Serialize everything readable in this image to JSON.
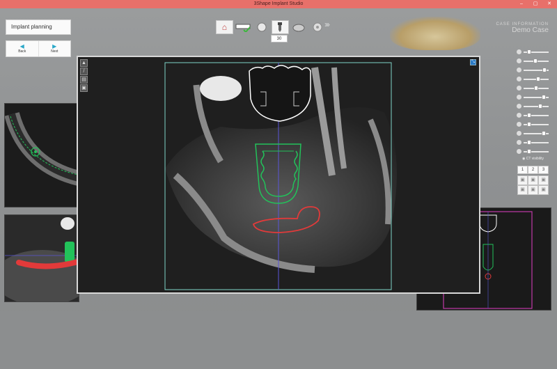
{
  "window": {
    "title": "3Shape Implant Studio",
    "controls": [
      "–",
      "▢",
      "✕"
    ]
  },
  "planning_panel": {
    "label": "Implant planning"
  },
  "navigation": {
    "back_label": "Back",
    "next_label": "Next"
  },
  "toolbar": {
    "tools": [
      "home-icon",
      "panoramic-icon",
      "crown-icon",
      "implant-icon",
      "guide-icon",
      "export-icon"
    ],
    "zoom_value": "30"
  },
  "case": {
    "line1": "CASE INFORMATION",
    "line2": "Demo Case"
  },
  "right_panel": {
    "sliders": [
      {
        "icon": "implant-visibility-icon",
        "value": 0.15
      },
      {
        "icon": "crown-visibility-icon",
        "value": 0.45
      },
      {
        "icon": "guide-visibility-icon",
        "value": 0.9
      },
      {
        "icon": "abutment-visibility-icon",
        "value": 0.6
      },
      {
        "icon": "sleeve-visibility-icon",
        "value": 0.5
      },
      {
        "icon": "ct-visibility-icon",
        "value": 0.85
      },
      {
        "icon": "tooth-visibility-icon",
        "value": 0.7
      },
      {
        "icon": "scan-visibility-icon",
        "value": 0.15
      },
      {
        "icon": "nerve-visibility-icon",
        "value": 0.15
      },
      {
        "icon": "model-visibility-icon",
        "value": 0.85
      },
      {
        "icon": "settings-visibility-icon",
        "value": 0.15
      },
      {
        "icon": "contrast-icon",
        "value": 0.15
      }
    ],
    "ct_visibility_label": "CT visibility",
    "layout_tabs": [
      "1",
      "2",
      "3"
    ],
    "view_buttons": [
      "view-front-icon",
      "view-side-icon",
      "view-top-icon",
      "view-back-icon",
      "view-left-icon",
      "view-right-icon"
    ]
  },
  "colors": {
    "implant_outline": "#22c25a",
    "nerve_canal": "#e23a3a",
    "crown_outline": "#ffffff",
    "crosshair_vertical": "#5a56d8",
    "frame_cyan": "#7fd4c8",
    "frame_magenta": "#c03aa8"
  }
}
